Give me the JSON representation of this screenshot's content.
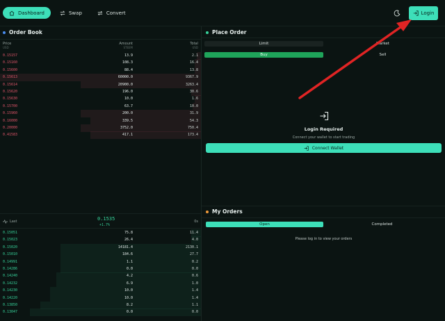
{
  "nav": {
    "items": [
      {
        "label": "Dashboard",
        "icon": "home-icon",
        "active": true
      },
      {
        "label": "Swap",
        "icon": "swap-icon",
        "active": false
      },
      {
        "label": "Convert",
        "icon": "convert-icon",
        "active": false
      }
    ],
    "login_label": "Login"
  },
  "order_book": {
    "title": "Order Book",
    "headers": {
      "price": "Price",
      "price_unit": "USD",
      "amount": "Amount",
      "amount_unit": "STEEM",
      "total": "Total",
      "total_unit": "USD"
    },
    "asks": [
      {
        "price": "0.15157",
        "amount": "13.9",
        "total": "2.1",
        "depth": 0.02
      },
      {
        "price": "0.15160",
        "amount": "108.3",
        "total": "16.4",
        "depth": 0.03
      },
      {
        "price": "0.15600",
        "amount": "88.4",
        "total": "13.8",
        "depth": 0.03
      },
      {
        "price": "0.15613",
        "amount": "60000.0",
        "total": "9367.9",
        "depth": 1.0
      },
      {
        "price": "0.15614",
        "amount": "20900.0",
        "total": "3263.4",
        "depth": 0.6
      },
      {
        "price": "0.15620",
        "amount": "196.0",
        "total": "30.6",
        "depth": 0.05
      },
      {
        "price": "0.15630",
        "amount": "10.0",
        "total": "1.6",
        "depth": 0.03
      },
      {
        "price": "0.15700",
        "amount": "63.7",
        "total": "10.0",
        "depth": 0.04
      },
      {
        "price": "0.15960",
        "amount": "200.0",
        "total": "31.9",
        "depth": 0.6
      },
      {
        "price": "0.16000",
        "amount": "339.5",
        "total": "54.3",
        "depth": 0.55
      },
      {
        "price": "0.20000",
        "amount": "3752.0",
        "total": "750.4",
        "depth": 0.6
      },
      {
        "price": "0.41583",
        "amount": "417.1",
        "total": "173.4",
        "depth": 0.55
      }
    ],
    "last_label": "Last",
    "last_price": "0.1535",
    "last_change": "+1.7%",
    "age_label": "0s",
    "bids": [
      {
        "price": "0.15051",
        "amount": "75.8",
        "total": "11.4",
        "depth": 0.05
      },
      {
        "price": "0.15023",
        "amount": "26.4",
        "total": "4.0",
        "depth": 0.05
      },
      {
        "price": "0.15020",
        "amount": "14181.4",
        "total": "2130.1",
        "depth": 0.7
      },
      {
        "price": "0.15010",
        "amount": "184.6",
        "total": "27.7",
        "depth": 0.7
      },
      {
        "price": "0.14991",
        "amount": "1.1",
        "total": "0.2",
        "depth": 0.7
      },
      {
        "price": "0.14286",
        "amount": "0.0",
        "total": "0.0",
        "depth": 0.7
      },
      {
        "price": "0.14240",
        "amount": "4.2",
        "total": "0.6",
        "depth": 0.72
      },
      {
        "price": "0.14232",
        "amount": "6.9",
        "total": "1.0",
        "depth": 0.72
      },
      {
        "price": "0.14230",
        "amount": "10.0",
        "total": "1.4",
        "depth": 0.75
      },
      {
        "price": "0.14220",
        "amount": "10.0",
        "total": "1.4",
        "depth": 0.75
      },
      {
        "price": "0.13850",
        "amount": "8.2",
        "total": "1.1",
        "depth": 0.8
      },
      {
        "price": "0.13047",
        "amount": "0.0",
        "total": "0.0",
        "depth": 0.85
      }
    ]
  },
  "place_order": {
    "title": "Place Order",
    "order_types": [
      "Limit",
      "Market"
    ],
    "sides": [
      "Buy",
      "Sell"
    ],
    "login_title": "Login Required",
    "login_subtitle": "Connect your wallet to start trading",
    "connect_label": "Connect Wallet"
  },
  "my_orders": {
    "title": "My Orders",
    "tabs": [
      "Open",
      "Completed"
    ],
    "empty_message": "Please log in to view your orders"
  },
  "colors": {
    "accent": "#3ddfb9",
    "ask": "#e0556a",
    "bid": "#37d39b",
    "background": "#0b1412",
    "annotation_arrow": "#e02424"
  }
}
